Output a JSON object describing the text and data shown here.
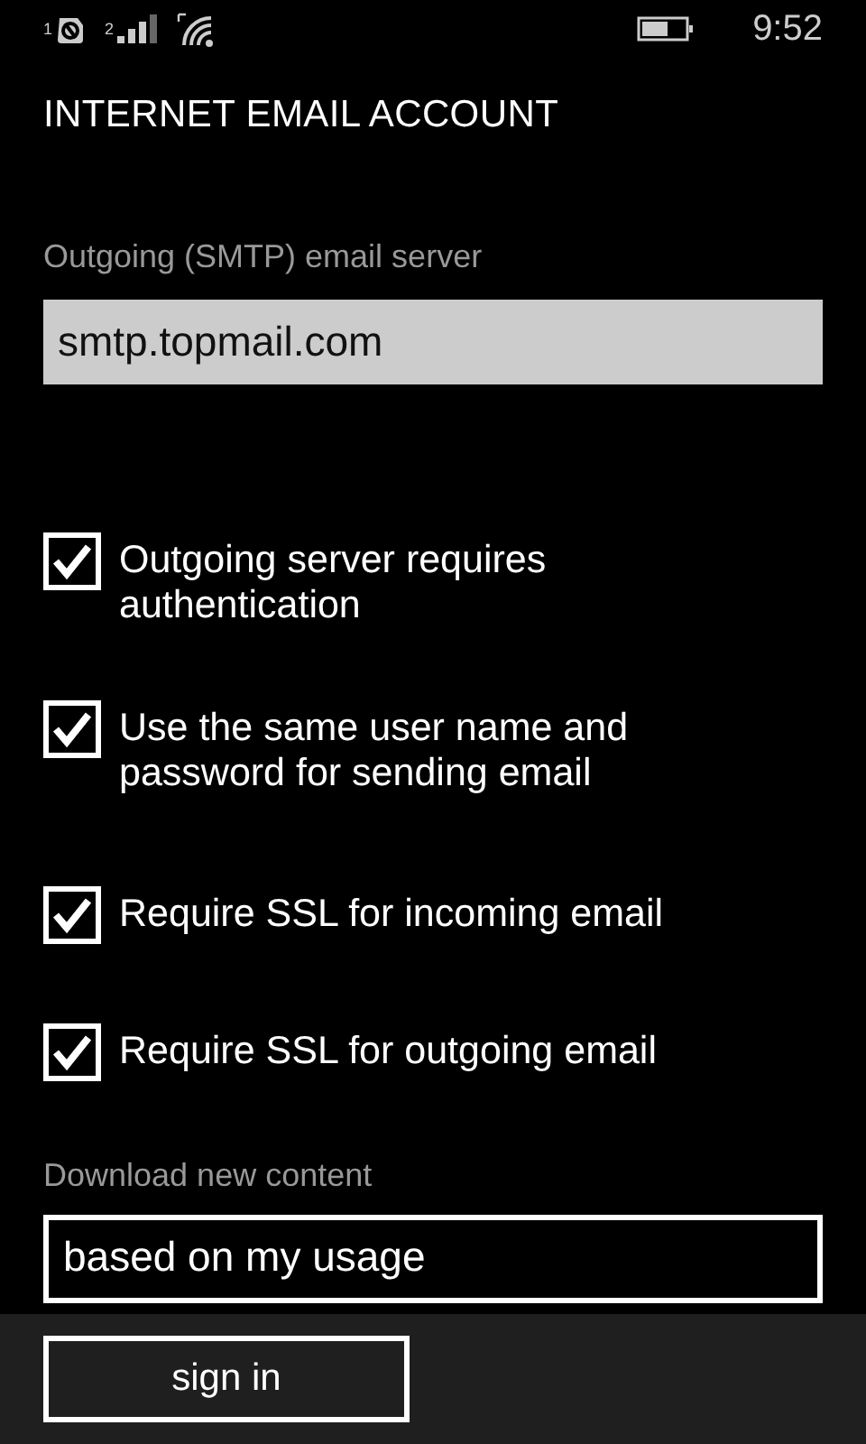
{
  "status_bar": {
    "sim_badge": "1",
    "signal_sim": "2",
    "time": "9:52"
  },
  "title": "INTERNET EMAIL ACCOUNT",
  "server_field": {
    "label": "Outgoing (SMTP) email server",
    "value": "smtp.topmail.com"
  },
  "options": [
    {
      "label": "Outgoing server requires authentication",
      "checked": true
    },
    {
      "label": "Use the same user name and password for sending email",
      "checked": true
    },
    {
      "label": "Require SSL for incoming email",
      "checked": true
    },
    {
      "label": "Require SSL for outgoing email",
      "checked": true
    }
  ],
  "download": {
    "label": "Download new content",
    "value": "based on my usage"
  },
  "app_bar": {
    "button": "sign in"
  }
}
